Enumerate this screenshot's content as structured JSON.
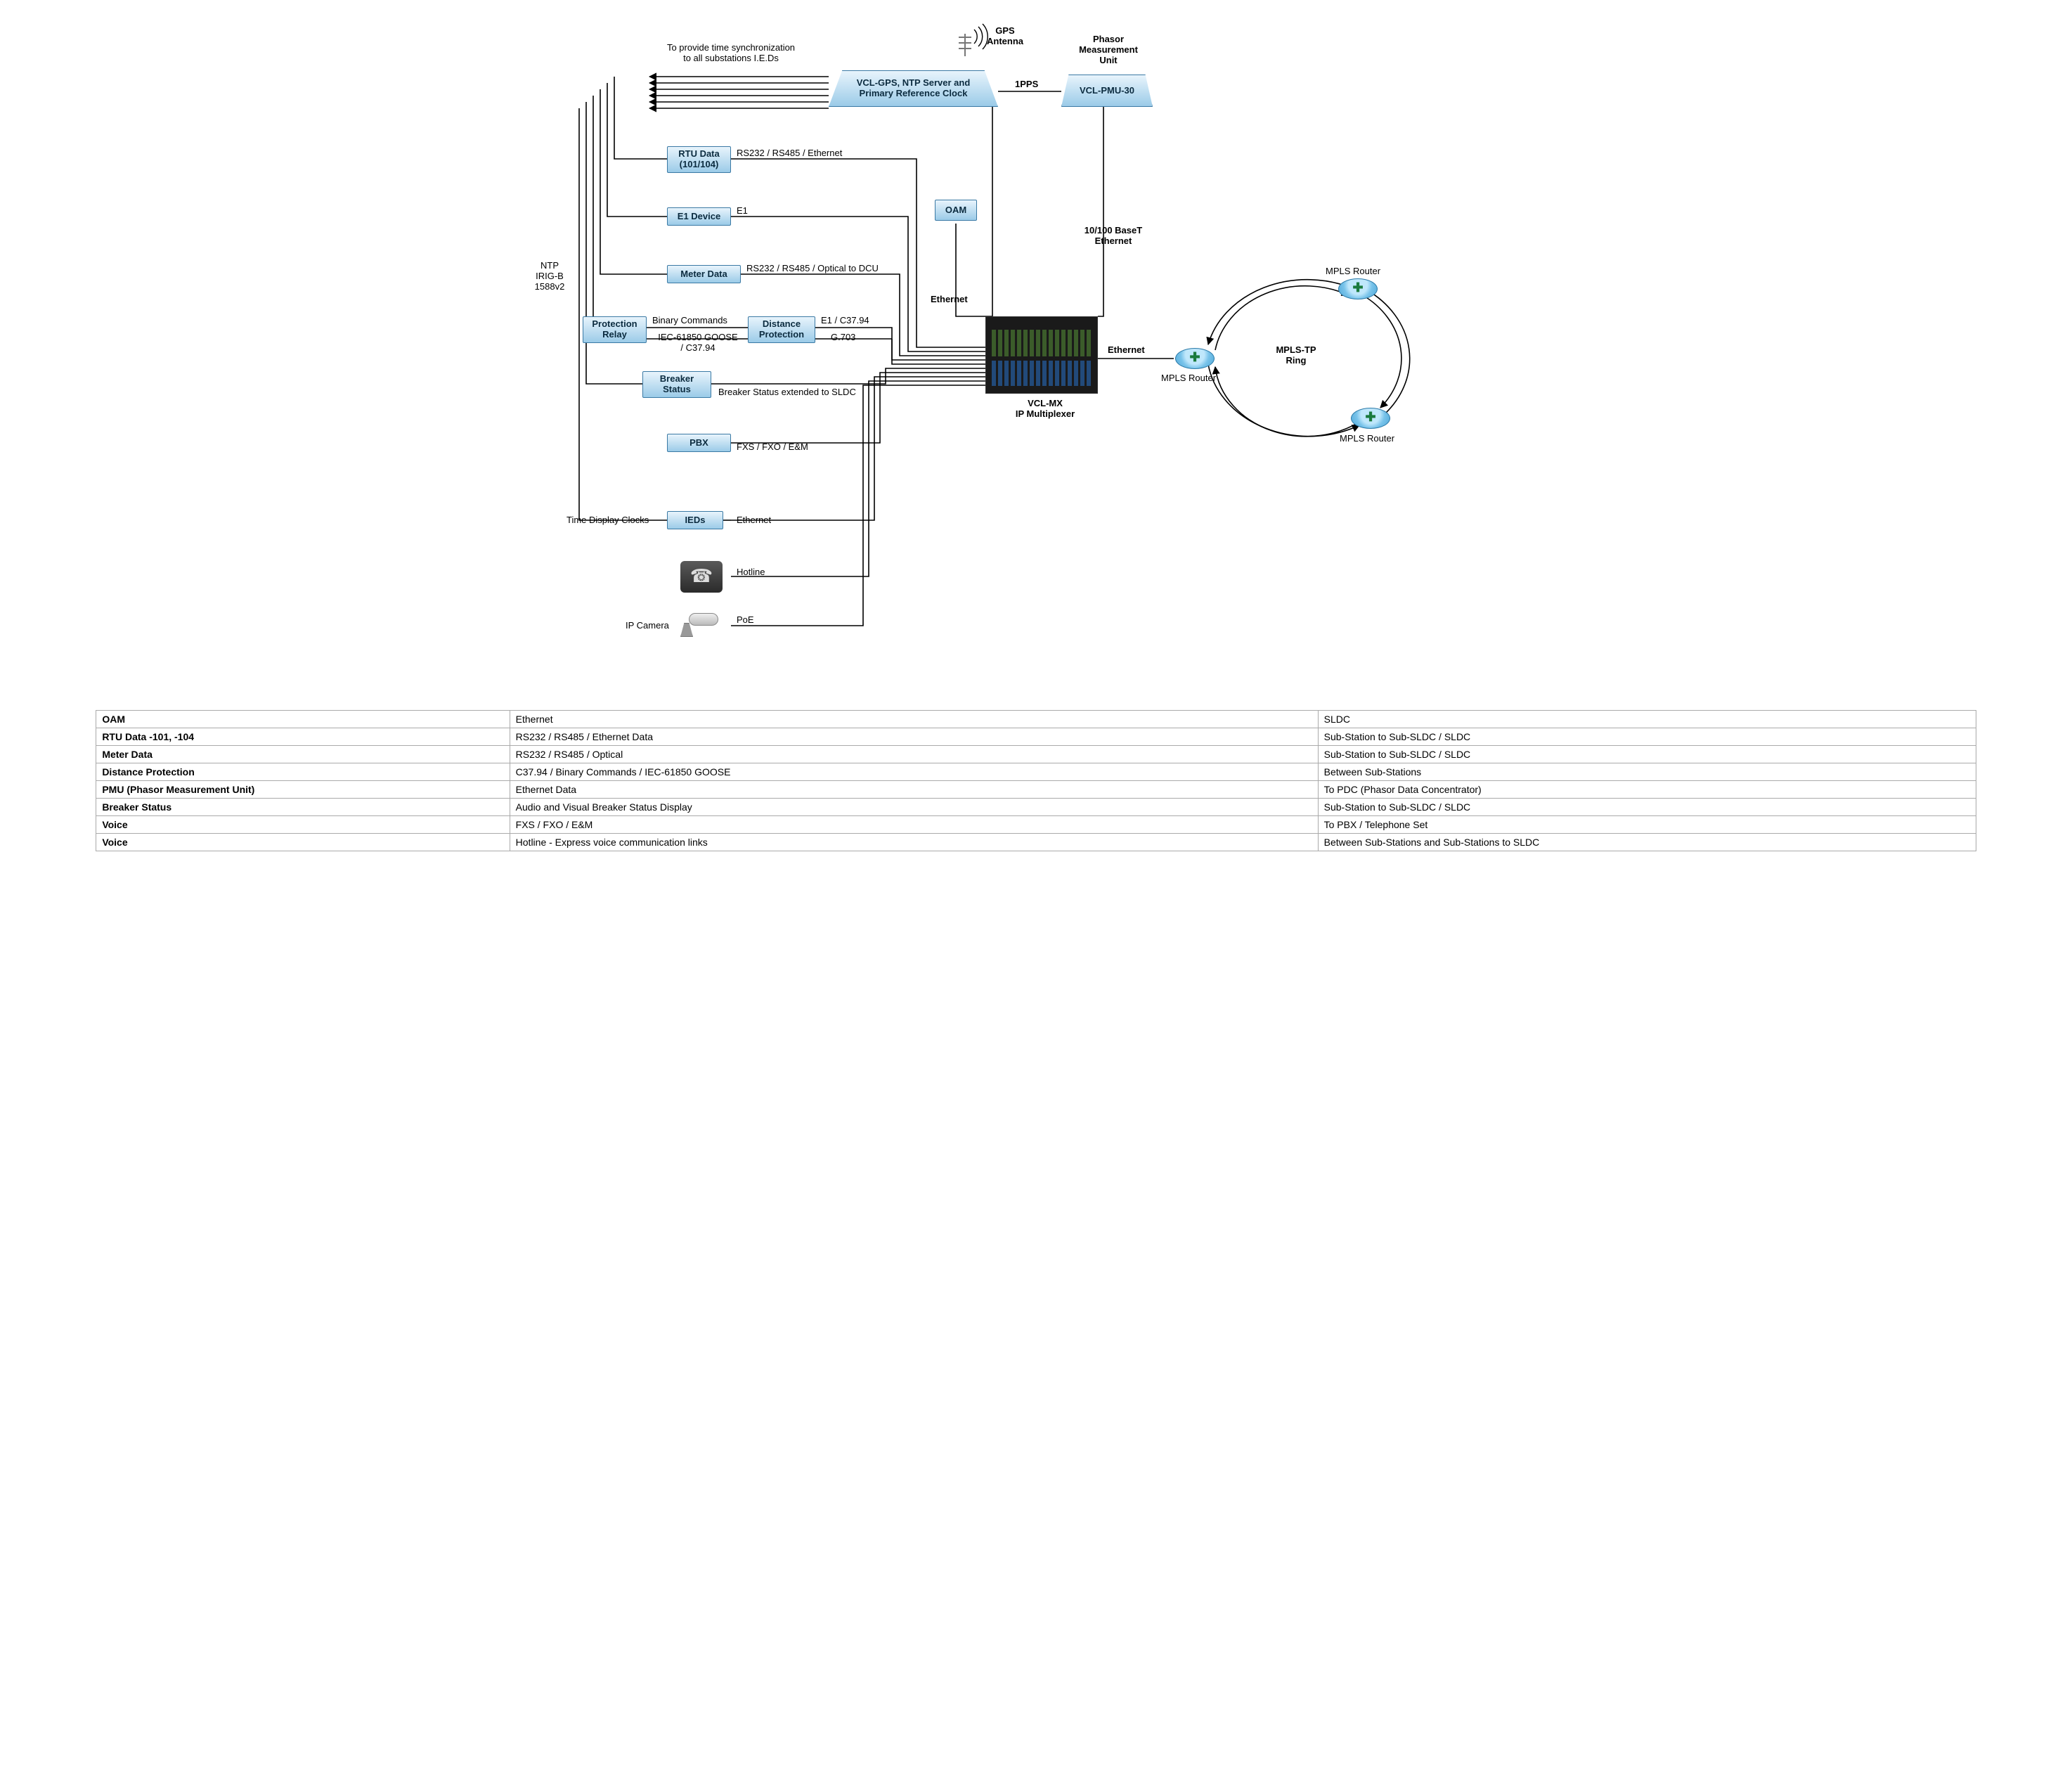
{
  "annotations": {
    "sync_note": "To provide time synchronization\nto all substations I.E.Ds",
    "gps_antenna": "GPS\nAntenna",
    "pmu_title": "Phasor\nMeasurement\nUnit",
    "link_1pps": "1PPS",
    "left_protocols": "NTP\nIRIG-B\n1588v2",
    "rtu_right": "RS232 / RS485 / Ethernet",
    "e1_right": "E1",
    "meter_right": "RS232 / RS485 / Optical to DCU",
    "prot_relay_right_top": "Binary Commands",
    "prot_relay_right_bot": "IEC-61850 GOOSE\n/ C37.94",
    "dist_prot_right_top": "E1 / C37.94",
    "dist_prot_right_bot": "G.703",
    "breaker_right": "Breaker Status extended to SLDC",
    "pbx_right": "FXS / FXO / E&M",
    "ieds_left": "Time Display Clocks",
    "ieds_right": "Ethernet",
    "hotline": "Hotline",
    "ipcam_left": "IP Camera",
    "ipcam_right": "PoE",
    "mux_eth_mid": "Ethernet",
    "pmu_link": "10/100 BaseT\nEthernet",
    "mux_to_ring": "Ethernet",
    "mux_caption": "VCL-MX\nIP Multiplexer",
    "ring_center": "MPLS-TP\nRing",
    "router_label": "MPLS Router"
  },
  "nodes": {
    "clock": "VCL-GPS, NTP Server and\nPrimary Reference Clock",
    "pmu": "VCL-PMU-30",
    "rtu": "RTU Data\n(101/104)",
    "e1": "E1 Device",
    "oam": "OAM",
    "meter": "Meter Data",
    "prot_relay": "Protection\nRelay",
    "dist_prot": "Distance\nProtection",
    "breaker": "Breaker\nStatus",
    "pbx": "PBX",
    "ieds": "IEDs"
  },
  "table": [
    {
      "c1": "OAM",
      "c2": "Ethernet",
      "c3": "SLDC"
    },
    {
      "c1": "RTU Data -101, -104",
      "c2": "RS232 / RS485 / Ethernet Data",
      "c3": "Sub-Station to Sub-SLDC / SLDC"
    },
    {
      "c1": "Meter Data",
      "c2": "RS232 / RS485 / Optical",
      "c3": "Sub-Station to Sub-SLDC / SLDC"
    },
    {
      "c1": "Distance Protection",
      "c2": "C37.94 / Binary Commands / IEC-61850 GOOSE",
      "c3": "Between Sub-Stations"
    },
    {
      "c1": "PMU (Phasor Measurement Unit)",
      "c2": "Ethernet Data",
      "c3": "To PDC (Phasor Data Concentrator)"
    },
    {
      "c1": "Breaker Status",
      "c2": "Audio and Visual Breaker Status Display",
      "c3": "Sub-Station to Sub-SLDC / SLDC"
    },
    {
      "c1": "Voice",
      "c2": "FXS / FXO / E&M",
      "c3": "To PBX / Telephone Set"
    },
    {
      "c1": "Voice",
      "c2": "Hotline - Express voice communication links",
      "c3": "Between Sub-Stations and Sub-Stations to SLDC"
    }
  ]
}
